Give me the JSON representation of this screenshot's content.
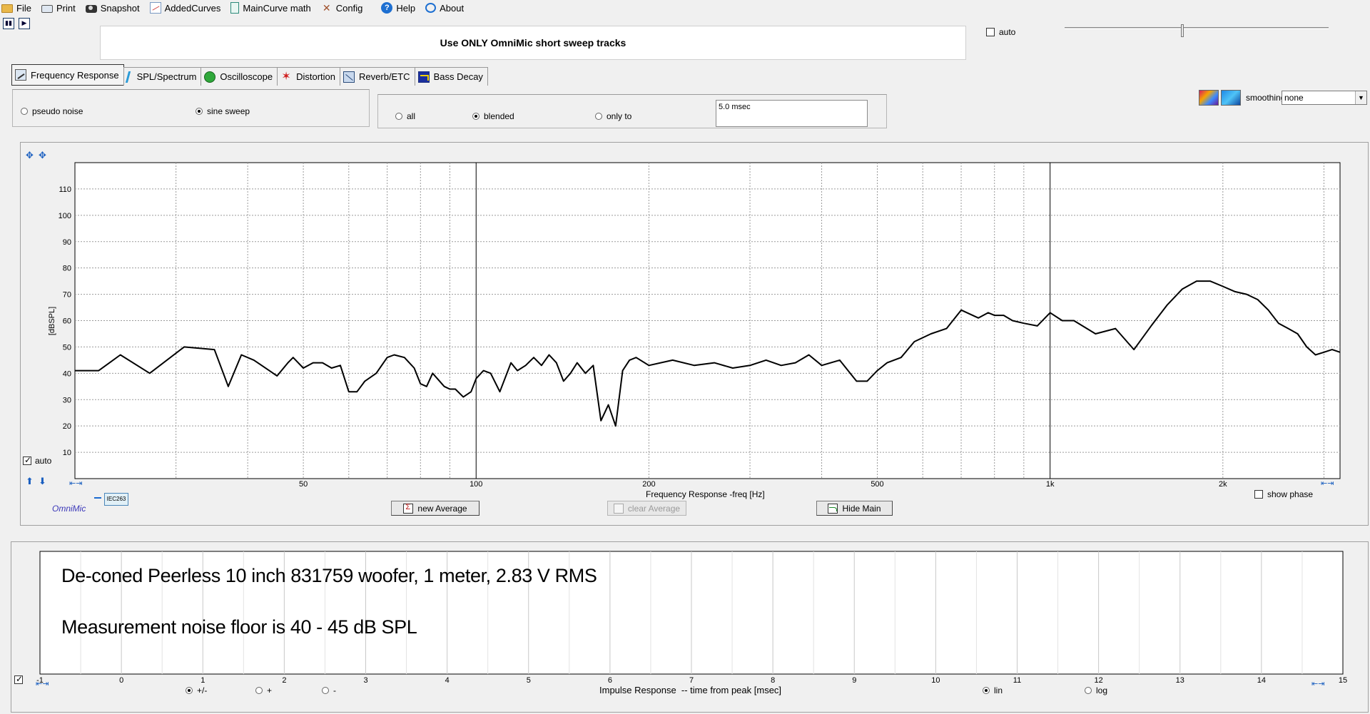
{
  "menu": [
    {
      "label": "File",
      "icon": "folder-icon"
    },
    {
      "label": "Print",
      "icon": "printer-icon"
    },
    {
      "label": "Snapshot",
      "icon": "camera-icon"
    },
    {
      "label": "AddedCurves",
      "icon": "curves-icon"
    },
    {
      "label": "MainCurve math",
      "icon": "document-icon"
    },
    {
      "label": "Config",
      "icon": "tools-icon"
    },
    {
      "label": "Help",
      "icon": "help-icon"
    },
    {
      "label": "About",
      "icon": "about-icon"
    }
  ],
  "banner": "Use ONLY OmniMic short sweep tracks",
  "top_auto_label": "auto",
  "tabs": [
    {
      "label": "Frequency Response",
      "active": true
    },
    {
      "label": "SPL/Spectrum",
      "active": false
    },
    {
      "label": "Oscilloscope",
      "active": false
    },
    {
      "label": "Distortion",
      "active": false
    },
    {
      "label": "Reverb/ETC",
      "active": false
    },
    {
      "label": "Bass Decay",
      "active": false
    }
  ],
  "signal": {
    "pseudo_noise": "pseudo noise",
    "sine_sweep": "sine sweep",
    "selected": "sine sweep"
  },
  "window": {
    "all": "all",
    "blended": "blended",
    "only_to": "only to",
    "selected": "blended",
    "time": "5.0 msec"
  },
  "smoothing": {
    "label": "smoothing",
    "value": "none"
  },
  "chart": {
    "auto_label": "auto",
    "omnimic_label": "OmniMic",
    "legend_box": "IEC263",
    "new_average": "new Average",
    "clear_average": "clear Average",
    "hide_main": "Hide Main",
    "show_phase": "show phase",
    "xlabel": "Frequency Response -freq [Hz]",
    "ylabel": "[dBSPL]"
  },
  "chart_data": {
    "type": "line",
    "xlabel": "Frequency Response -freq [Hz]",
    "ylabel": "[dBSPL]",
    "x_scale": "log",
    "xlim": [
      20,
      3200
    ],
    "ylim": [
      0,
      120
    ],
    "x_ticks": [
      50,
      100,
      200,
      500,
      1000,
      2000
    ],
    "x_tick_labels": [
      "50",
      "100",
      "200",
      "500",
      "1k",
      "2k"
    ],
    "y_ticks": [
      10,
      20,
      30,
      40,
      50,
      60,
      70,
      80,
      90,
      100,
      110
    ],
    "grid": true,
    "series": [
      {
        "x": [
          20,
          22,
          24,
          27,
          31,
          35,
          37,
          39,
          41,
          45,
          47,
          48,
          50,
          52,
          54,
          56,
          58,
          60,
          62,
          64,
          67,
          70,
          72,
          75,
          78,
          80,
          82,
          84,
          88,
          90,
          92,
          95,
          98,
          100,
          103,
          106,
          110,
          115,
          118,
          122,
          126,
          130,
          134,
          138,
          142,
          146,
          150,
          155,
          160,
          165,
          170,
          175,
          180,
          185,
          190,
          200,
          220,
          240,
          260,
          280,
          300,
          320,
          340,
          360,
          380,
          400,
          430,
          460,
          480,
          500,
          520,
          550,
          580,
          620,
          660,
          700,
          750,
          780,
          800,
          830,
          860,
          900,
          950,
          1000,
          1050,
          1100,
          1200,
          1300,
          1400,
          1500,
          1600,
          1700,
          1800,
          1900,
          2000,
          2100,
          2200,
          2300,
          2400,
          2500,
          2600,
          2700,
          2800,
          2900,
          3000,
          3100,
          3200
        ],
        "y": [
          41,
          41,
          47,
          40,
          50,
          49,
          35,
          47,
          45,
          39,
          44,
          46,
          42,
          44,
          44,
          42,
          43,
          33,
          33,
          37,
          40,
          46,
          47,
          46,
          42,
          36,
          35,
          40,
          35,
          34,
          34,
          31,
          33,
          38,
          41,
          40,
          33,
          44,
          41,
          43,
          46,
          43,
          47,
          44,
          37,
          40,
          44,
          40,
          43,
          22,
          28,
          20,
          41,
          45,
          46,
          43,
          45,
          43,
          44,
          42,
          43,
          45,
          43,
          44,
          47,
          43,
          45,
          37,
          37,
          41,
          44,
          46,
          52,
          55,
          57,
          64,
          61,
          63,
          62,
          62,
          60,
          59,
          58,
          63,
          60,
          60,
          55,
          57,
          49,
          58,
          66,
          72,
          75,
          75,
          73,
          71,
          70,
          68,
          64,
          59,
          57,
          55,
          50,
          47,
          48,
          49,
          48
        ]
      }
    ]
  },
  "impulse": {
    "note1": "De-coned Peerless 10 inch 831759 woofer, 1 meter, 2.83 V RMS",
    "note2": "Measurement noise floor is 40 - 45 dB SPL",
    "xlabel": "Impulse Response  -- time from peak [msec]",
    "x_tick_labels": [
      "-1",
      "0",
      "1",
      "2",
      "3",
      "4",
      "5",
      "6",
      "7",
      "8",
      "9",
      "10",
      "11",
      "12",
      "13",
      "14",
      "15"
    ],
    "polarity": {
      "both": "+/-",
      "plus": "+",
      "minus": "-",
      "selected": "+/-"
    },
    "scale": {
      "lin": "lin",
      "log": "log",
      "selected": "lin"
    }
  }
}
